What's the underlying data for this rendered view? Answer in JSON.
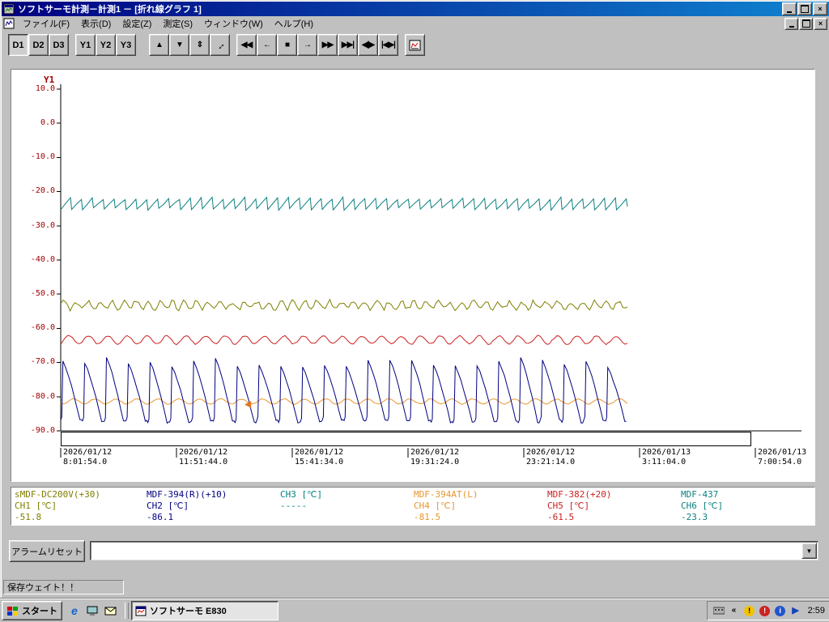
{
  "window": {
    "title": "ソフトサーモ計測－計測1 － [折れ線グラフ 1]"
  },
  "menu": {
    "items": [
      "ファイル(F)",
      "表示(D)",
      "設定(Z)",
      "測定(S)",
      "ウィンドウ(W)",
      "ヘルプ(H)"
    ]
  },
  "toolbar": {
    "d_buttons": [
      "D1",
      "D2",
      "D3"
    ],
    "y_buttons": [
      "Y1",
      "Y2",
      "Y3"
    ],
    "nav_buttons": [
      {
        "name": "scroll-up",
        "glyph": "▲"
      },
      {
        "name": "scroll-down",
        "glyph": "▼"
      },
      {
        "name": "scroll-up-down",
        "glyph": "⇕"
      },
      {
        "name": "zoom-diagonal",
        "glyph": "↔"
      }
    ],
    "media_buttons": [
      {
        "name": "rewind",
        "glyph": "◀◀"
      },
      {
        "name": "step-back",
        "glyph": "←"
      },
      {
        "name": "stop",
        "glyph": "■"
      },
      {
        "name": "step-forward",
        "glyph": "→"
      },
      {
        "name": "fast-forward",
        "glyph": "▶▶"
      },
      {
        "name": "to-end",
        "glyph": "▶▶|"
      },
      {
        "name": "expand-time",
        "glyph": "◀|▶"
      },
      {
        "name": "compress-time",
        "glyph": "|◀▶|"
      }
    ],
    "extra_button_icon": "mini-graph-icon"
  },
  "chart_data": {
    "type": "line",
    "title": "折れ線グラフ 1",
    "y_axis": {
      "label": "Y1",
      "min": -90,
      "max": 10,
      "color": "#a00000",
      "ticks": [
        "10.0",
        "0.0",
        "-10.0",
        "-20.0",
        "-30.0",
        "-40.0",
        "-50.0",
        "-60.0",
        "-70.0",
        "-80.0",
        "-90.0"
      ]
    },
    "x_axis": {
      "ticks": [
        {
          "date": "2026/01/12",
          "time": "8:01:54.0"
        },
        {
          "date": "2026/01/12",
          "time": "11:51:44.0"
        },
        {
          "date": "2026/01/12",
          "time": "15:41:34.0"
        },
        {
          "date": "2026/01/12",
          "time": "19:31:24.0"
        },
        {
          "date": "2026/01/12",
          "time": "23:21:14.0"
        },
        {
          "date": "2026/01/13",
          "time": "3:11:04.0"
        },
        {
          "date": "2026/01/13",
          "time": "7:00:54.0"
        }
      ]
    },
    "data_fraction": 0.765,
    "series": [
      {
        "channel": "CH1",
        "name": "sMDF-DC200V(+30)",
        "color": "#7f7f00",
        "waveform": "noisy",
        "mean": -53.2,
        "amplitude": 1.1,
        "cycles": 47,
        "noise": 1.3,
        "current": -51.8
      },
      {
        "channel": "CH2",
        "name": "MDF-394(R)(+10)",
        "color": "#000080",
        "waveform": "spike",
        "base": -87.2,
        "peak": -70.0,
        "cycles": 26,
        "current": -86.1
      },
      {
        "channel": "CH3",
        "name": "",
        "color": "#008080",
        "waveform": "none",
        "current": null
      },
      {
        "channel": "CH4",
        "name": "MDF-394AT(L)",
        "color": "#e8952f",
        "waveform": "sine",
        "mean": -81.4,
        "amplitude": 0.75,
        "cycles": 27,
        "noise": 0.25,
        "current": -81.5
      },
      {
        "channel": "CH5",
        "name": "MDF-382(+20)",
        "color": "#cc2020",
        "waveform": "sine",
        "mean": -63.4,
        "amplitude": 1.2,
        "cycles": 29,
        "noise": 0.45,
        "current": -61.5
      },
      {
        "channel": "CH6",
        "name": "MDF-437",
        "color": "#0e8080",
        "waveform": "sawtooth",
        "low": -25.1,
        "high": -22.0,
        "cycles": 52,
        "current": -23.3
      }
    ],
    "marker": {
      "x_fraction": 0.336,
      "value": -82.3,
      "color": "#e07820"
    }
  },
  "legend": {
    "channels": [
      {
        "name": "sMDF-DC200V(+30)",
        "label": "CH1 [℃]",
        "value": "-51.8",
        "color": "#7f7f00"
      },
      {
        "name": "MDF-394(R)(+10)",
        "label": "CH2 [℃]",
        "value": "-86.1",
        "color": "#000080"
      },
      {
        "name": "",
        "label": "CH3 [℃]",
        "value": "-----",
        "color": "#008080"
      },
      {
        "name": "MDF-394AT(L)",
        "label": "CH4 [℃]",
        "value": "-81.5",
        "color": "#e8952f"
      },
      {
        "name": "MDF-382(+20)",
        "label": "CH5 [℃]",
        "value": "-61.5",
        "color": "#cc2020"
      },
      {
        "name": "MDF-437",
        "label": "CH6 [℃]",
        "value": "-23.3",
        "color": "#0e8080"
      }
    ]
  },
  "alarm": {
    "reset_button": "アラームリセット",
    "selector_value": ""
  },
  "status": {
    "text": "保存ウェイト！！"
  },
  "taskbar": {
    "start": "スタート",
    "quick_launch": [
      "ie-icon",
      "desktop-icon",
      "mail-icon"
    ],
    "task": {
      "label": "ソフトサーモ  E830",
      "active": true
    },
    "tray_icons": [
      "input-device-icon",
      "collapse-chevron-icon",
      "warning-tray-icon",
      "alert-tray-icon",
      "info-tray-icon",
      "play-tray-icon"
    ],
    "clock": "2:59"
  }
}
